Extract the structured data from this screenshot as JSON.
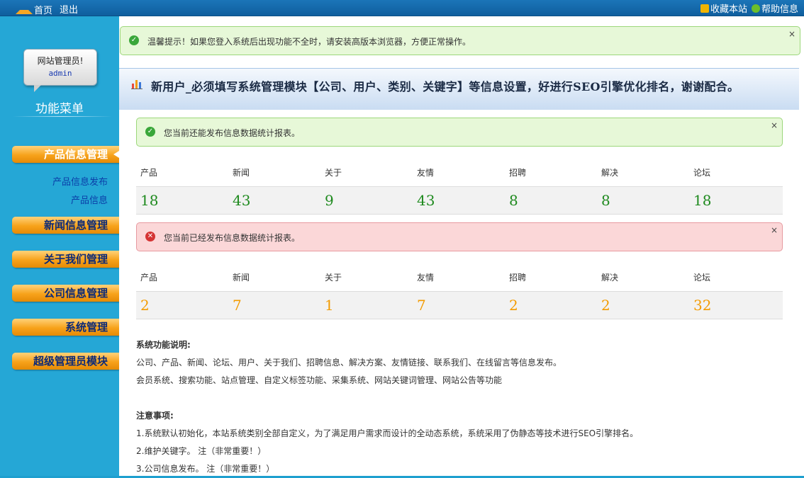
{
  "topbar": {
    "home": "首页",
    "logout": "退出",
    "bookmark": "收藏本站",
    "help": "帮助信息"
  },
  "sidebar": {
    "admin_greeting": "网站管理员!",
    "admin_name": "admin",
    "menu_title": "功能菜单",
    "menus": [
      {
        "label": "产品信息管理",
        "active": true,
        "sub": [
          "产品信息发布",
          "产品信息"
        ]
      },
      {
        "label": "新闻信息管理"
      },
      {
        "label": "关于我们管理"
      },
      {
        "label": "公司信息管理"
      },
      {
        "label": "系统管理"
      },
      {
        "label": "超级管理员模块"
      }
    ]
  },
  "main": {
    "tip": "温馨提示！如果您登入系统后出现功能不全时，请安装高版本浏览器，方便正常操作。",
    "headline": "新用户_必须填写系统管理模块【公司、用户、类别、关键字】等信息设置，好进行SEO引擎优化排名，谢谢配合。",
    "ok_notice": "您当前还能发布信息数据统计报表。",
    "err_notice": "您当前已经发布信息数据统计报表。",
    "columns": [
      "产品",
      "新闻",
      "关于",
      "友情",
      "招聘",
      "解决",
      "论坛"
    ],
    "remaining": [
      "18",
      "43",
      "9",
      "43",
      "8",
      "8",
      "18"
    ],
    "published": [
      "2",
      "7",
      "1",
      "7",
      "2",
      "2",
      "32"
    ],
    "close": "×",
    "features_title": "系统功能说明:",
    "features": [
      "公司、产品、新闻、论坛、用户、关于我们、招聘信息、解决方案、友情链接、联系我们、在线留言等信息发布。",
      "会员系统、搜索功能、站点管理、自定义标签功能、采集系统、网站关键词管理、网站公告等功能"
    ],
    "notes_title": "注意事项:",
    "notes": [
      "1.系统默认初始化，本站系统类别全部自定义，为了满足用户需求而设计的全动态系统，系统采用了伪静态等技术进行SEO引擎排名。",
      "2.维护关键字。 注（非常重要！）",
      "3.公司信息发布。 注（非常重要！）"
    ]
  }
}
